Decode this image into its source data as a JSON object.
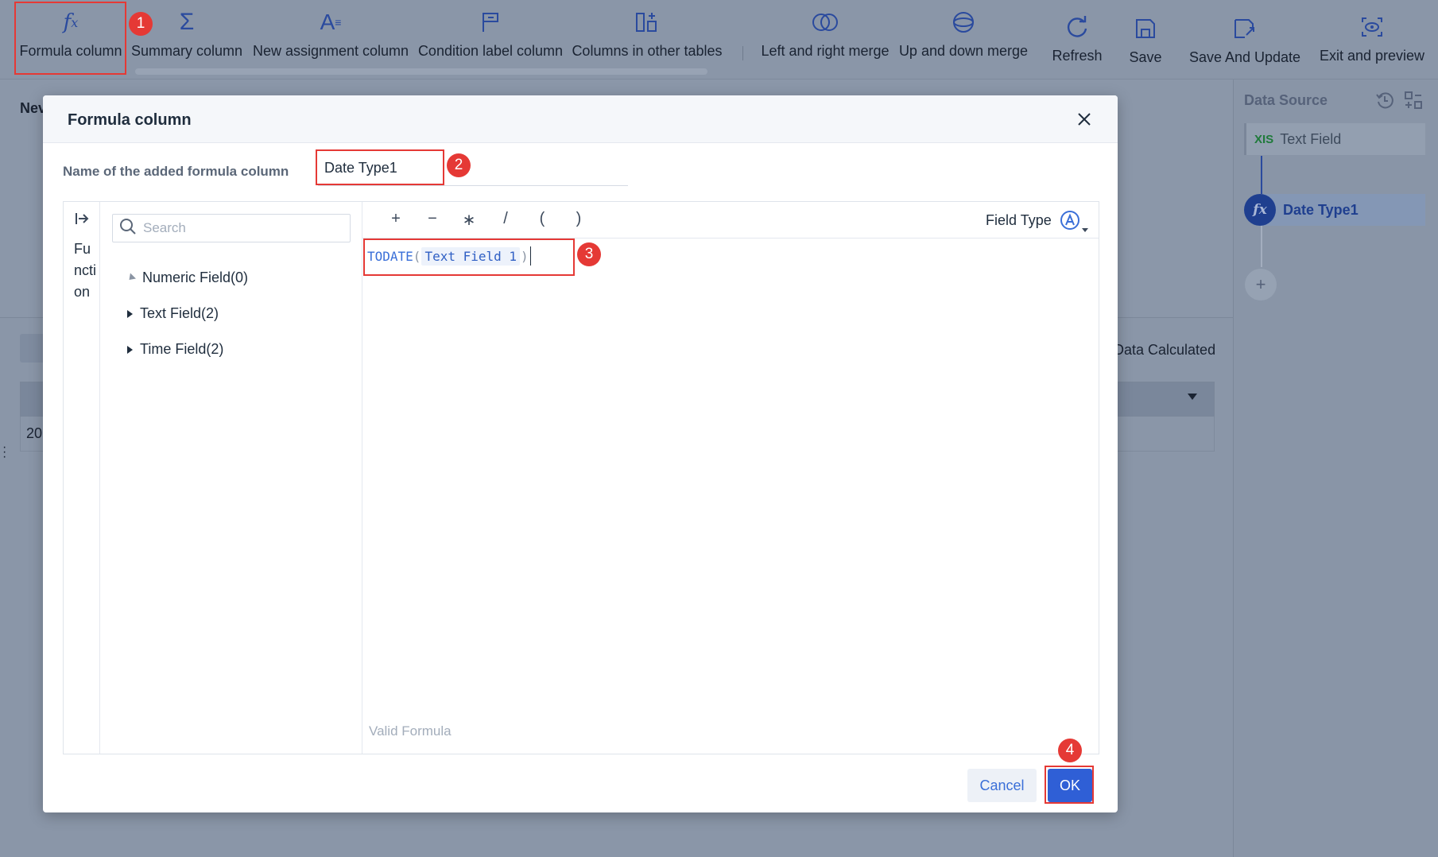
{
  "toolbar": {
    "items": [
      {
        "label": "Formula column",
        "icon": "fx-icon"
      },
      {
        "label": "Summary column",
        "icon": "sigma-icon"
      },
      {
        "label": "New assignment column",
        "icon": "assign-text-icon"
      },
      {
        "label": "Condition label column",
        "icon": "flag-icon"
      },
      {
        "label": "Columns in other tables",
        "icon": "add-column-icon"
      },
      {
        "label": "Left and right merge",
        "icon": "venn-icon"
      },
      {
        "label": "Up and down merge",
        "icon": "stack-circle-icon"
      },
      {
        "label": "Refresh",
        "icon": "refresh-icon"
      },
      {
        "label": "Save",
        "icon": "save-icon"
      },
      {
        "label": "Save And Update",
        "icon": "save-update-icon"
      },
      {
        "label": "Exit and preview",
        "icon": "preview-eye-icon"
      }
    ]
  },
  "background": {
    "section_title": "Nev",
    "calc_label": "Data Calculated",
    "cell_value": "20"
  },
  "sidebar": {
    "title": "Data Source",
    "nodes": [
      {
        "badge": "XIS",
        "label": "Text Field"
      },
      {
        "badge": "fx",
        "label": "Date Type1"
      }
    ],
    "add_label": "+"
  },
  "dialog": {
    "title": "Formula column",
    "name_label": "Name of the added formula column",
    "name_value": "Date Type1",
    "function_tab": "Function",
    "search_placeholder": "Search",
    "tree": [
      {
        "label": "Numeric Field(0)",
        "expanded": true
      },
      {
        "label": "Text Field(2)",
        "expanded": false
      },
      {
        "label": "Time Field(2)",
        "expanded": false
      }
    ],
    "operators": [
      "+",
      "−",
      "∗",
      "/",
      "(",
      ")"
    ],
    "field_type_label": "Field Type",
    "formula": {
      "fn": "TODATE",
      "open": "(",
      "arg": "Text Field 1",
      "close": ")"
    },
    "status": "Valid Formula",
    "cancel_label": "Cancel",
    "ok_label": "OK"
  },
  "annotations": [
    "1",
    "2",
    "3",
    "4"
  ],
  "colors": {
    "accent": "#2f5fd6",
    "highlight": "#e53935",
    "overlay": "#8a96a8"
  }
}
